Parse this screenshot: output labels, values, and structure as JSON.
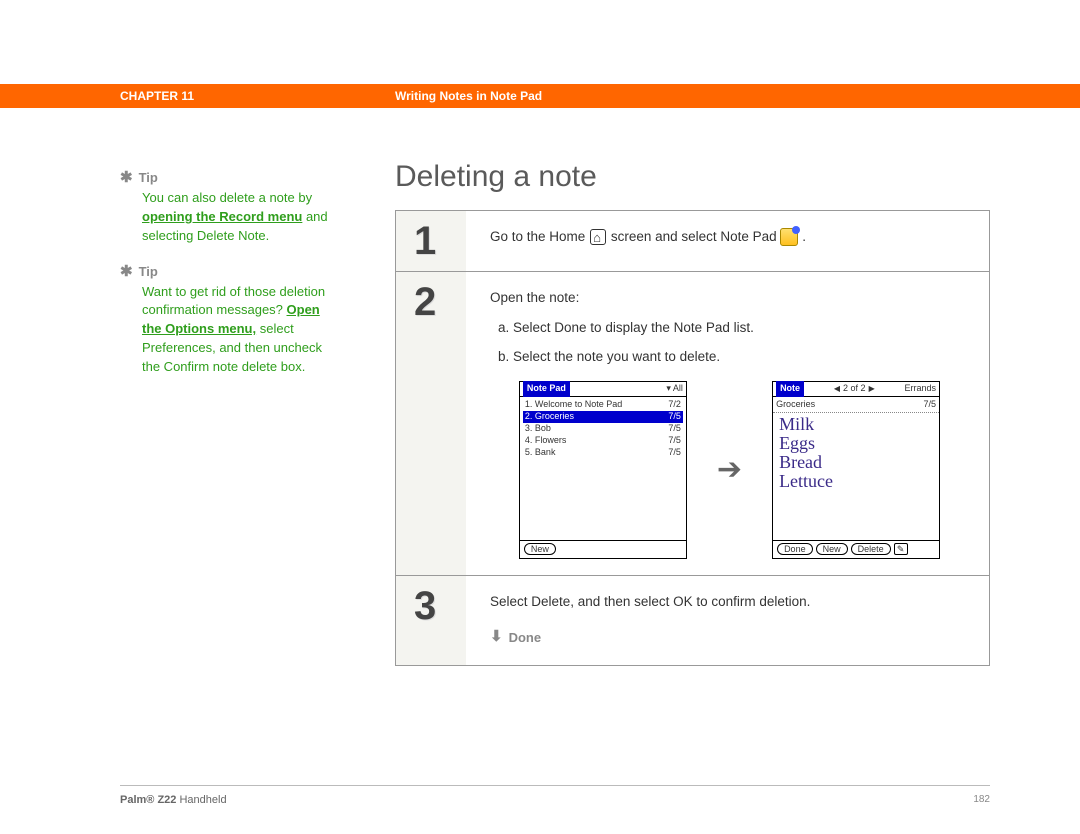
{
  "header": {
    "chapter": "CHAPTER 11",
    "section_title": "Writing Notes in Note Pad"
  },
  "sidebar": {
    "tip_label": "Tip",
    "tip1_pre": "You can also delete a note by ",
    "tip1_link": "opening the Record menu",
    "tip1_post": " and selecting Delete Note.",
    "tip2_pre": "Want to get rid of those deletion confirmation messages? ",
    "tip2_link": "Open the Options menu,",
    "tip2_post": " select Preferences, and then uncheck the Confirm note delete box."
  },
  "main": {
    "title": "Deleting a note",
    "step1_num": "1",
    "step1_pre": "Go to the Home ",
    "step1_post": " screen and select Note Pad ",
    "step1_end": ".",
    "step2_num": "2",
    "step2_intro": "Open the note:",
    "step2_a": "a.  Select Done to display the Note Pad list.",
    "step2_b": "b.  Select the note you want to delete.",
    "step3_num": "3",
    "step3_text": "Select Delete, and then select OK to confirm deletion.",
    "done_label": "Done"
  },
  "palm_list": {
    "title": "Note Pad",
    "filter": "All",
    "rows": [
      {
        "label": "1. Welcome to Note Pad",
        "date": "7/2"
      },
      {
        "label": "2. Groceries",
        "date": "7/5"
      },
      {
        "label": "3. Bob",
        "date": "7/5"
      },
      {
        "label": "4. Flowers",
        "date": "7/5"
      },
      {
        "label": "5. Bank",
        "date": "7/5"
      }
    ],
    "new_btn": "New"
  },
  "palm_note": {
    "title": "Note",
    "nav": "2 of 2",
    "category": "Errands",
    "meta_name": "Groceries",
    "meta_date": "7/5",
    "lines": [
      "Milk",
      "Eggs",
      "Bread",
      "Lettuce"
    ],
    "done_btn": "Done",
    "new_btn": "New",
    "delete_btn": "Delete"
  },
  "footer": {
    "product_bold": "Palm®",
    "product_model": " Z22",
    "product_rest": " Handheld",
    "page": "182"
  }
}
